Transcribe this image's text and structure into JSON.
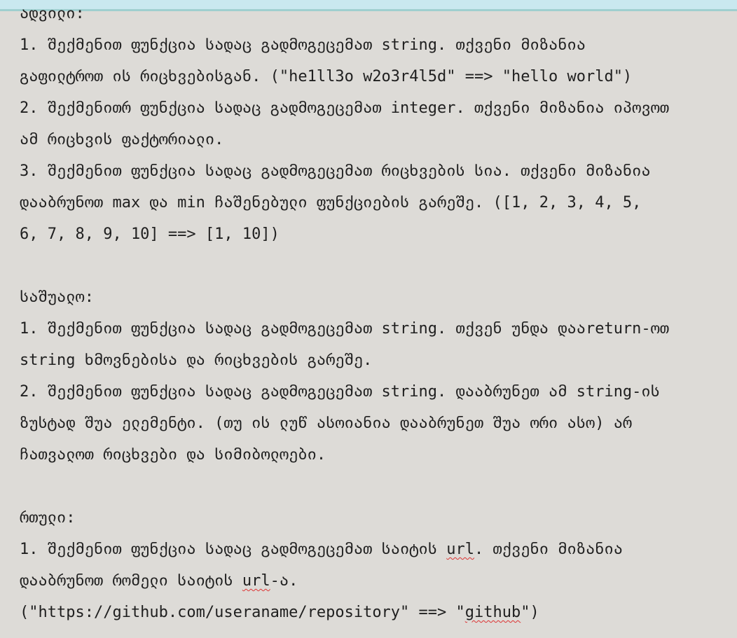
{
  "document": {
    "lines": [
      "ადვილი:",
      "1. შექმენით ფუნქცია სადაც გადმოგეცემათ string. თქვენი მიზანია",
      "გაფილტროთ ის რიცხვებისგან. (\"he1ll3o w2o3r4l5d\" ==> \"hello world\")",
      "2. შექმენითრ ფუნქცია სადაც გადმოგეცემათ integer. თქვენი მიზანია იპოვოთ",
      "ამ რიცხვის ფაქტორიალი.",
      "3. შექმენით ფუნქცია სადაც გადმოგეცემათ რიცხვების სია. თქვენი მიზანია",
      "დააბრუნოთ max და min ჩაშენებული ფუნქციების გარეშე. ([1, 2, 3, 4, 5,",
      "6, 7, 8, 9, 10] ==> [1, 10])",
      "საშუალო:",
      "1. შექმენით ფუნქცია სადაც გადმოგეცემათ string. თქვენ უნდა დააreturn-ოთ",
      "string ხმოვნებისა და რიცხვების გარეშე.",
      "2. შექმენით ფუნქცია სადაც გადმოგეცემათ string. დააბრუნეთ ამ string-ის",
      "ზუსტად შუა ელემენტი. (თუ ის ლუწ ასოიანია დააბრუნეთ შუა ორი ასო) არ",
      "ჩათვალოთ რიცხვები და სიმიბოლოები.",
      "რთული:",
      {
        "before": "1. შექმენით ფუნქცია სადაც გადმოგეცემათ საიტის ",
        "marked": "url",
        "after": ". თქვენი მიზანია"
      },
      {
        "before": "დააბრუნოთ რომელი საიტის ",
        "marked": "url",
        "after": "-ა."
      },
      {
        "before": "(\"https://github.com/useraname/repository\" ==> \"",
        "marked": "github",
        "after": "\")"
      }
    ]
  }
}
